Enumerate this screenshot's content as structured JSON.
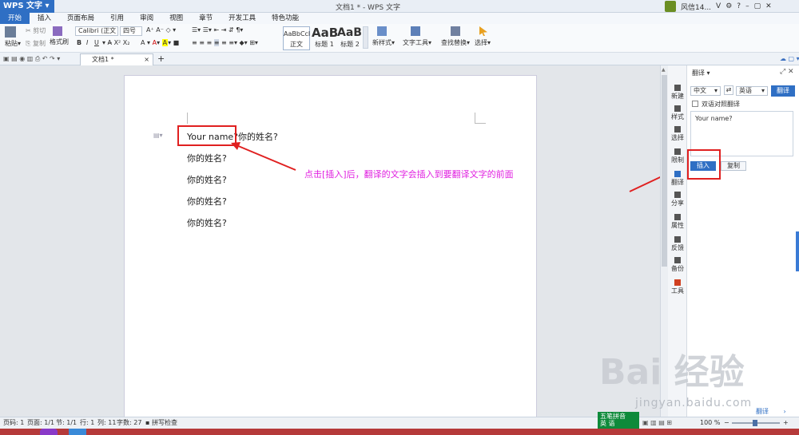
{
  "app": {
    "button_label": "WPS 文字",
    "doc_title": "文档1 * - WPS 文字",
    "user": "风信14...",
    "user_level": "V"
  },
  "menu": [
    "开始",
    "插入",
    "页面布局",
    "引用",
    "审阅",
    "视图",
    "章节",
    "开发工具",
    "特色功能"
  ],
  "ribbon": {
    "paste": "粘贴",
    "cut": "剪切",
    "copy": "复制",
    "format_painter": "格式刷",
    "font_name": "Calibri (正文",
    "font_size": "四号",
    "styles": [
      {
        "preview": "AaBbCcI",
        "name": "正文"
      },
      {
        "preview": "AaB",
        "name": "标题 1"
      },
      {
        "preview": "AaBl",
        "name": "标题 2"
      }
    ],
    "new_style": "新样式",
    "text_tool": "文字工具",
    "find_replace": "查找替换",
    "select": "选择"
  },
  "tabs": {
    "doc_tab": "文档1 *",
    "add": "+"
  },
  "document": {
    "lines": [
      "Your name?你的姓名?",
      "你的姓名?",
      "你的姓名?",
      "你的姓名?",
      "你的姓名?"
    ],
    "highlight": "Your name?",
    "annotation": "点击[插入]后，翻译的文字会插入到要翻译文字的前面"
  },
  "sidebar": [
    "新建",
    "样式",
    "选择",
    "限制",
    "翻译",
    "分享",
    "属性",
    "反馈",
    "备份",
    "工具"
  ],
  "translate_panel": {
    "title": "翻译",
    "from_lang": "中文",
    "to_lang": "英语",
    "translate_btn": "翻译",
    "checkbox_label": "双语对照翻译",
    "result": "Your name?",
    "insert_btn": "插入",
    "copy_btn": "复制"
  },
  "status": {
    "page": "页码: 1",
    "pages": "页面: 1/1",
    "section": "节: 1/1",
    "row": "行: 1",
    "col": "列: 11",
    "words": "字数: 27",
    "spell": "拼写检查",
    "zoom": "100 %",
    "panel_link": "翻译"
  },
  "ime": {
    "line1": "五笔拼音",
    "line2": "英 语"
  },
  "watermark": {
    "brand": "Bai 经验",
    "url": "jingyan.baidu.com"
  }
}
